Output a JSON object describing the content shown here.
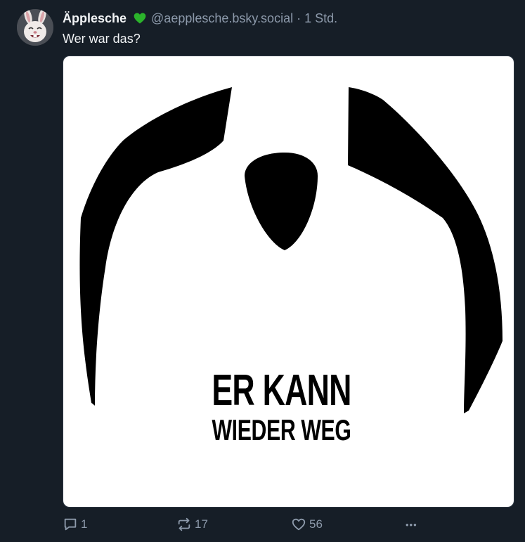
{
  "post": {
    "author": {
      "display_name": "Äpplesche",
      "handle": "@aepplesche.bsky.social",
      "avatar_icon": "rabbit-avatar-icon",
      "badge_icon": "green-heart-icon",
      "badge_color": "#2bb32b"
    },
    "separator": "·",
    "time": "1 Std.",
    "text": "Wer war das?",
    "image": {
      "line1": "ER KANN",
      "line2": "WIEDER WEG"
    },
    "actions": {
      "reply_count": "1",
      "repost_count": "17",
      "like_count": "56",
      "more_label": "•••"
    }
  },
  "colors": {
    "background": "#161e27",
    "text_primary": "#f1f3f5",
    "text_secondary": "#8d9aab"
  }
}
